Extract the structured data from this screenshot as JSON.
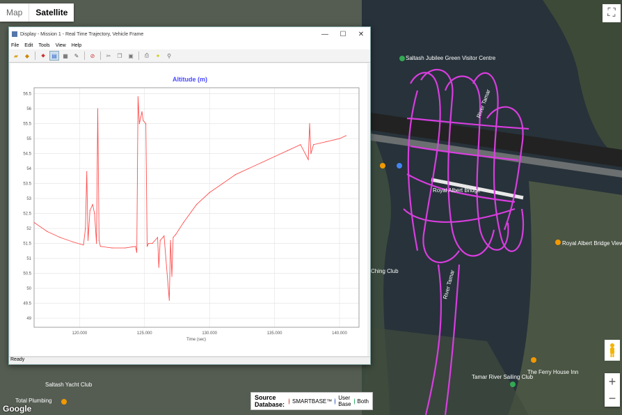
{
  "map": {
    "view_toggle": {
      "map": "Map",
      "satellite": "Satellite",
      "active": "Satellite"
    },
    "labels": [
      {
        "text": "Saltash Jubilee Green Visitor Centre"
      },
      {
        "text": "River Tamar"
      },
      {
        "text": "River Tamar"
      },
      {
        "text": "Royal Albert Bridge"
      },
      {
        "text": "Royal Albert Bridge View"
      },
      {
        "text": "Tamar River Sailing Club"
      },
      {
        "text": "The Ferry House Inn"
      },
      {
        "text": "Total Plumbing"
      },
      {
        "text": "Saltash Yacht Club"
      },
      {
        "text": "Ching Club"
      }
    ],
    "google_logo": "Google",
    "track_color": "#e23ee8",
    "source_legend": {
      "title": "Source Database:",
      "items": [
        {
          "label": "SMARTBASE™",
          "color": "#c0392b"
        },
        {
          "label": "User Base",
          "color": "#2a56c6"
        },
        {
          "label": "Both",
          "color": "#27ae60"
        }
      ]
    }
  },
  "window": {
    "title": "Display - Mission 1 - Real Time Trajectory, Vehicle Frame",
    "menu": [
      "File",
      "Edit",
      "Tools",
      "View",
      "Help"
    ],
    "status": "Ready"
  },
  "chart_data": {
    "type": "line",
    "title": "Altitude (m)",
    "xlabel": "Time (sec)",
    "ylabel": "",
    "xlim": [
      116.5,
      141.5
    ],
    "ylim": [
      48.7,
      56.7
    ],
    "x_ticks": [
      120,
      125,
      130,
      135,
      140
    ],
    "x_tick_labels": [
      "120.000",
      "125.000",
      "130.000",
      "135.000",
      "140.000"
    ],
    "y_ticks": [
      49,
      49.5,
      50,
      50.5,
      51,
      51.5,
      52,
      52.5,
      53,
      53.5,
      54,
      54.5,
      55,
      55.5,
      56,
      56.5
    ],
    "y_tick_labels": [
      "49",
      "49.5",
      "50",
      "50.5",
      "51",
      "51.5",
      "52",
      "52.5",
      "53",
      "53.5",
      "54",
      "54.5",
      "55",
      "55.5",
      "56",
      "56.5"
    ],
    "grid": true,
    "color": "#ff4d4d",
    "series": [
      {
        "x": [
          116.5,
          117.5,
          118.5,
          119.5,
          120.3,
          120.45,
          120.55,
          120.65,
          120.8,
          121.0,
          121.15,
          121.3,
          121.4,
          121.5,
          121.6,
          122.5,
          123.5,
          124.3,
          124.4,
          124.5,
          124.6,
          124.7,
          124.8,
          124.9,
          125.1,
          125.2,
          125.3,
          125.6,
          126.0,
          126.1,
          126.2,
          126.5,
          126.9,
          127.0,
          127.1,
          127.2,
          127.4,
          128.0,
          129.0,
          130.0,
          131.0,
          132.0,
          133.0,
          134.0,
          135.0,
          136.0,
          137.0,
          137.6,
          137.7,
          137.8,
          138.0,
          139.0,
          140.0,
          140.5
        ],
        "y": [
          52.2,
          51.9,
          51.7,
          51.55,
          51.45,
          52.0,
          53.9,
          51.6,
          52.6,
          52.8,
          52.5,
          51.5,
          56.0,
          51.6,
          51.4,
          51.35,
          51.35,
          51.4,
          51.2,
          56.4,
          55.5,
          55.7,
          55.9,
          55.6,
          55.5,
          51.4,
          51.5,
          51.5,
          51.7,
          50.7,
          51.6,
          51.75,
          49.6,
          51.6,
          50.4,
          51.7,
          51.8,
          52.2,
          52.8,
          53.2,
          53.5,
          53.8,
          54.0,
          54.2,
          54.4,
          54.6,
          54.8,
          54.3,
          55.5,
          54.5,
          54.8,
          54.9,
          55.0,
          55.1
        ]
      }
    ]
  }
}
